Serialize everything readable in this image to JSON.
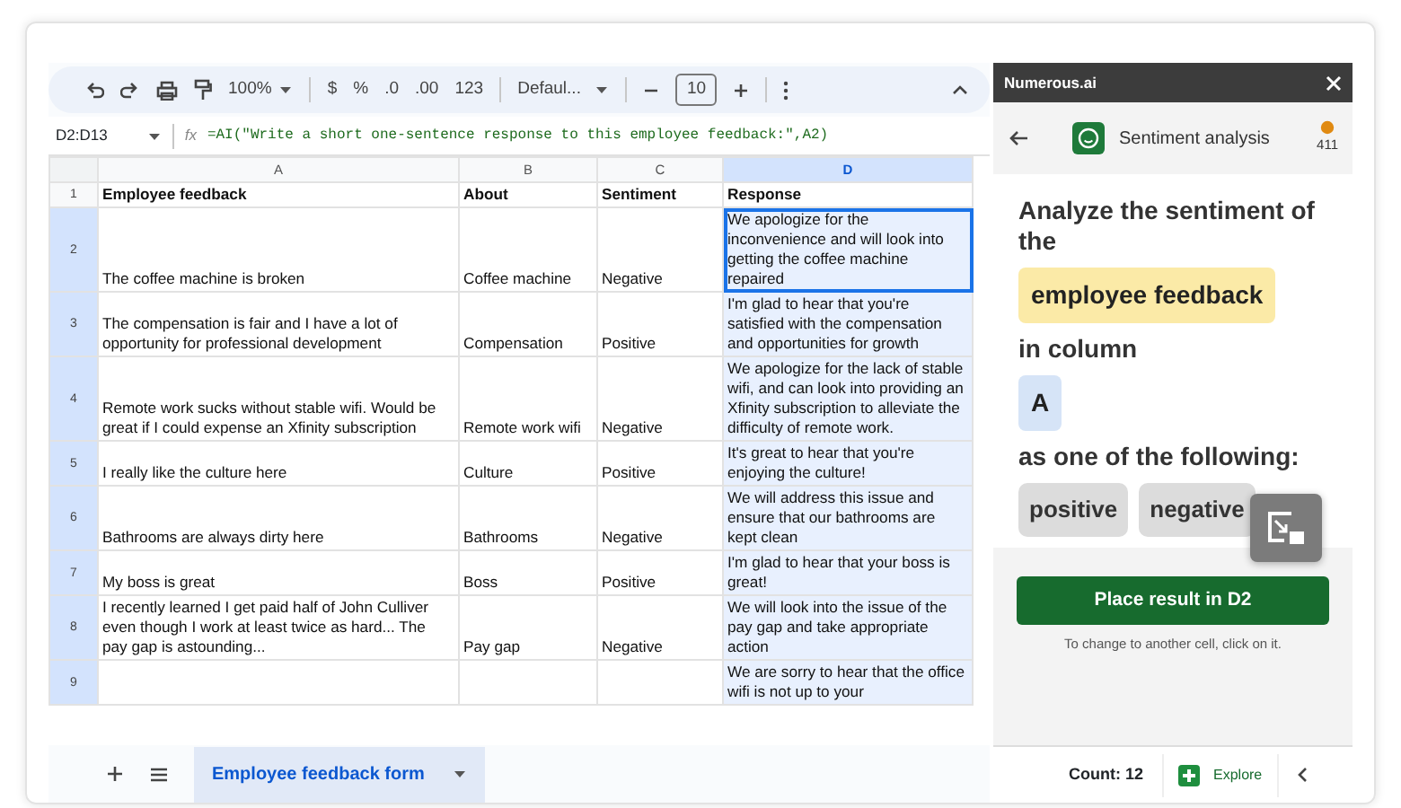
{
  "toolbar": {
    "zoom": "100%",
    "formats": [
      "$",
      "%",
      ".0",
      ".00",
      "123"
    ],
    "font": "Defaul...",
    "font_size": "10"
  },
  "formula_bar": {
    "cell_ref": "D2:D13",
    "fx_label": "fx",
    "formula": "=AI(\"Write a short one-sentence response to this employee feedback:\",A2)"
  },
  "columns": [
    {
      "label": "A",
      "selected": false
    },
    {
      "label": "B",
      "selected": false
    },
    {
      "label": "C",
      "selected": false
    },
    {
      "label": "D",
      "selected": true
    }
  ],
  "rows": [
    {
      "number": "1",
      "selected": false,
      "active": false,
      "header": true,
      "cells": [
        "Employee feedback",
        "About",
        "Sentiment",
        "Response"
      ]
    },
    {
      "number": "2",
      "selected": true,
      "active": true,
      "header": false,
      "cells": [
        "The coffee machine is broken",
        "Coffee machine",
        "Negative",
        "We apologize for the inconvenience and will look into getting the coffee machine repaired"
      ]
    },
    {
      "number": "3",
      "selected": true,
      "active": false,
      "header": false,
      "cells": [
        "The compensation is fair and I have a lot of opportunity for professional development",
        "Compensation",
        "Positive",
        "I'm glad to hear that you're satisfied with the compensation and opportunities for growth"
      ]
    },
    {
      "number": "4",
      "selected": true,
      "active": false,
      "header": false,
      "cells": [
        "Remote work sucks without stable wifi. Would be great if I could expense an Xfinity subscription",
        "Remote work wifi",
        "Negative",
        "We apologize for the lack of stable wifi, and can look into providing an Xfinity subscription to alleviate the difficulty of remote work."
      ]
    },
    {
      "number": "5",
      "selected": true,
      "active": false,
      "header": false,
      "cells": [
        "I really like the culture here",
        "Culture",
        "Positive",
        "It's great to hear that you're enjoying the culture!"
      ]
    },
    {
      "number": "6",
      "selected": true,
      "active": false,
      "header": false,
      "cells": [
        "Bathrooms are always dirty here",
        "Bathrooms",
        "Negative",
        "We will address this issue and ensure that our bathrooms are kept clean"
      ]
    },
    {
      "number": "7",
      "selected": true,
      "active": false,
      "header": false,
      "cells": [
        "My boss is great",
        "Boss",
        "Positive",
        "I'm glad to hear that your boss is great!"
      ]
    },
    {
      "number": "8",
      "selected": true,
      "active": false,
      "header": false,
      "cells": [
        "I recently learned I get paid half of John Culliver even though I work at least twice as hard...  The pay gap is astounding...",
        "Pay gap",
        "Negative",
        "We will look into the issue of the pay gap and take appropriate action"
      ]
    },
    {
      "number": "9",
      "selected": true,
      "active": false,
      "header": false,
      "cells": [
        "",
        "",
        "",
        "We are sorry to hear that the office wifi is not up to your"
      ]
    }
  ],
  "sheet_tabs": [
    {
      "label": "Employee feedback form",
      "selected": true
    }
  ],
  "panel": {
    "title": "Numerous.ai",
    "tool": "Sentiment analysis",
    "credits": "411",
    "prompt": [
      {
        "kind": "text",
        "text": "Analyze the sentiment of the"
      },
      {
        "kind": "chip",
        "text": "employee feedback"
      },
      {
        "kind": "text",
        "text": "in column"
      },
      {
        "kind": "column",
        "text": "A"
      },
      {
        "kind": "text",
        "text": "as one of the following:"
      }
    ],
    "options": [
      "positive",
      "negative"
    ],
    "button": "Place result in D2",
    "hint": "To change to another cell, click on it."
  },
  "status_bar": {
    "count": "Count: 12",
    "explore": "Explore"
  }
}
